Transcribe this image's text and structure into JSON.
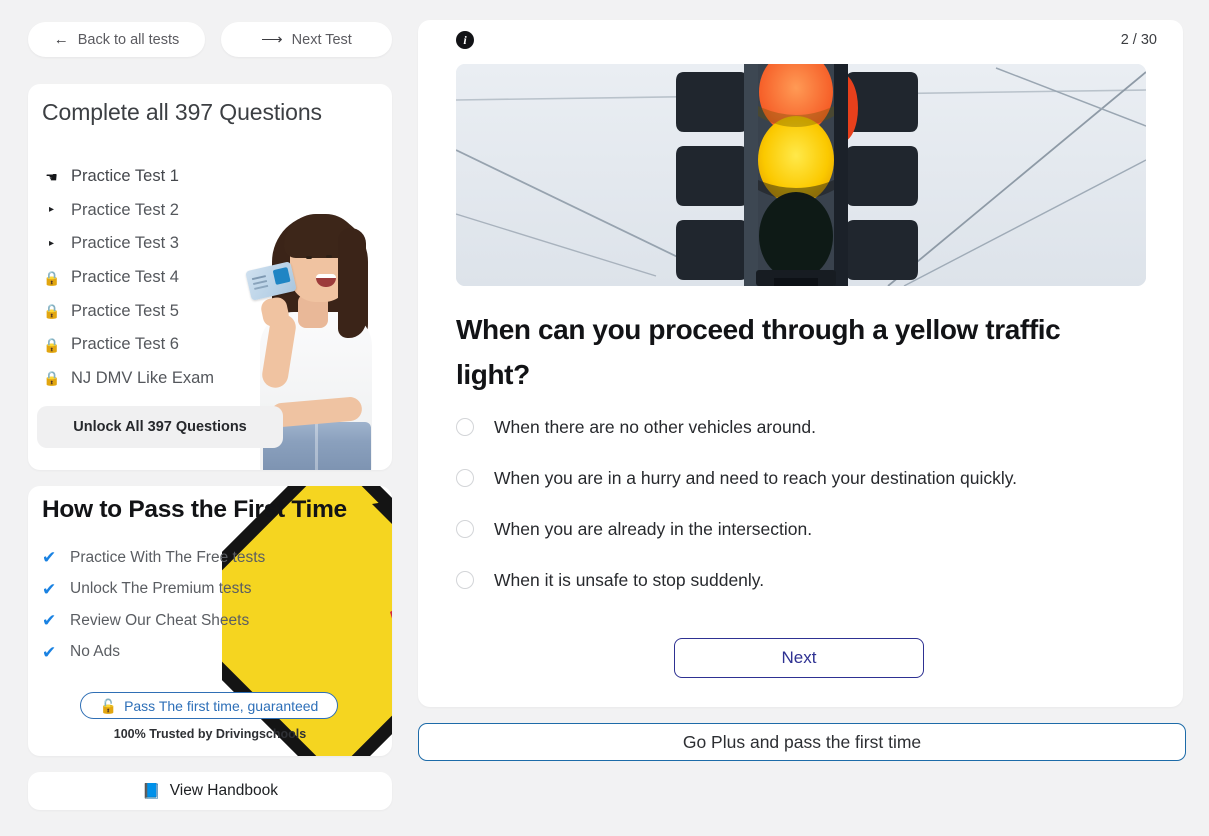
{
  "topbar": {
    "back_label": "Back to all tests",
    "back_icon": "arrow-left-icon",
    "next_label": "Next Test",
    "next_icon": "arrow-right-icon"
  },
  "sidebar": {
    "tests_card": {
      "title": "Complete all 397 Questions",
      "items": [
        {
          "label": "Practice Test 1",
          "icon": "pointing-hand-icon",
          "state": "active"
        },
        {
          "label": "Practice Test 2",
          "icon": "triangle-right-icon",
          "state": "available"
        },
        {
          "label": "Practice Test 3",
          "icon": "triangle-right-icon",
          "state": "available"
        },
        {
          "label": "Practice Test 4",
          "icon": "lock-icon",
          "state": "locked"
        },
        {
          "label": "Practice Test 5",
          "icon": "lock-icon",
          "state": "locked"
        },
        {
          "label": "Practice Test 6",
          "icon": "lock-icon",
          "state": "locked"
        },
        {
          "label": "NJ DMV Like Exam",
          "icon": "lock-icon",
          "state": "locked"
        }
      ],
      "unlock_label": "Unlock All 397 Questions"
    },
    "pass_card": {
      "title": "How to Pass the First Time",
      "benefits": [
        {
          "label": "Practice With The Free tests",
          "icon": "check-icon"
        },
        {
          "label": "Unlock The Premium tests",
          "icon": "check-icon"
        },
        {
          "label": "Review Our Cheat Sheets",
          "icon": "check-icon"
        },
        {
          "label": "No Ads",
          "icon": "check-icon"
        }
      ],
      "guarantee_label": "Pass The first time, guaranteed",
      "guarantee_icon": "unlock-padlock-icon",
      "trusted_note": "100% Trusted by Drivingschools"
    },
    "handbook": {
      "label": "View Handbook",
      "icon": "book-icon"
    }
  },
  "main": {
    "info_icon": "info-circle-icon",
    "info_glyph": "i",
    "counter": "2 / 30",
    "image_alt": "traffic-light-yellow-illuminated",
    "question": "When can you proceed through a yellow traffic light?",
    "options": [
      {
        "label": "When there are no other vehicles around.",
        "selected": false
      },
      {
        "label": "When you are in a hurry and need to reach your destination quickly.",
        "selected": false
      },
      {
        "label": "When you are already in the intersection.",
        "selected": false
      },
      {
        "label": "When it is unsafe to stop suddenly.",
        "selected": false
      }
    ],
    "next_label": "Next",
    "go_plus_label": "Go Plus and pass the first time"
  },
  "colors": {
    "page_bg": "#f2f2f3",
    "card_bg": "#ffffff",
    "accent_blue": "#1a7fe0",
    "next_border": "#2e3192",
    "go_plus_border": "#1d6ba8",
    "sign_yellow": "#f5d520",
    "sign_red": "#d7283f"
  }
}
